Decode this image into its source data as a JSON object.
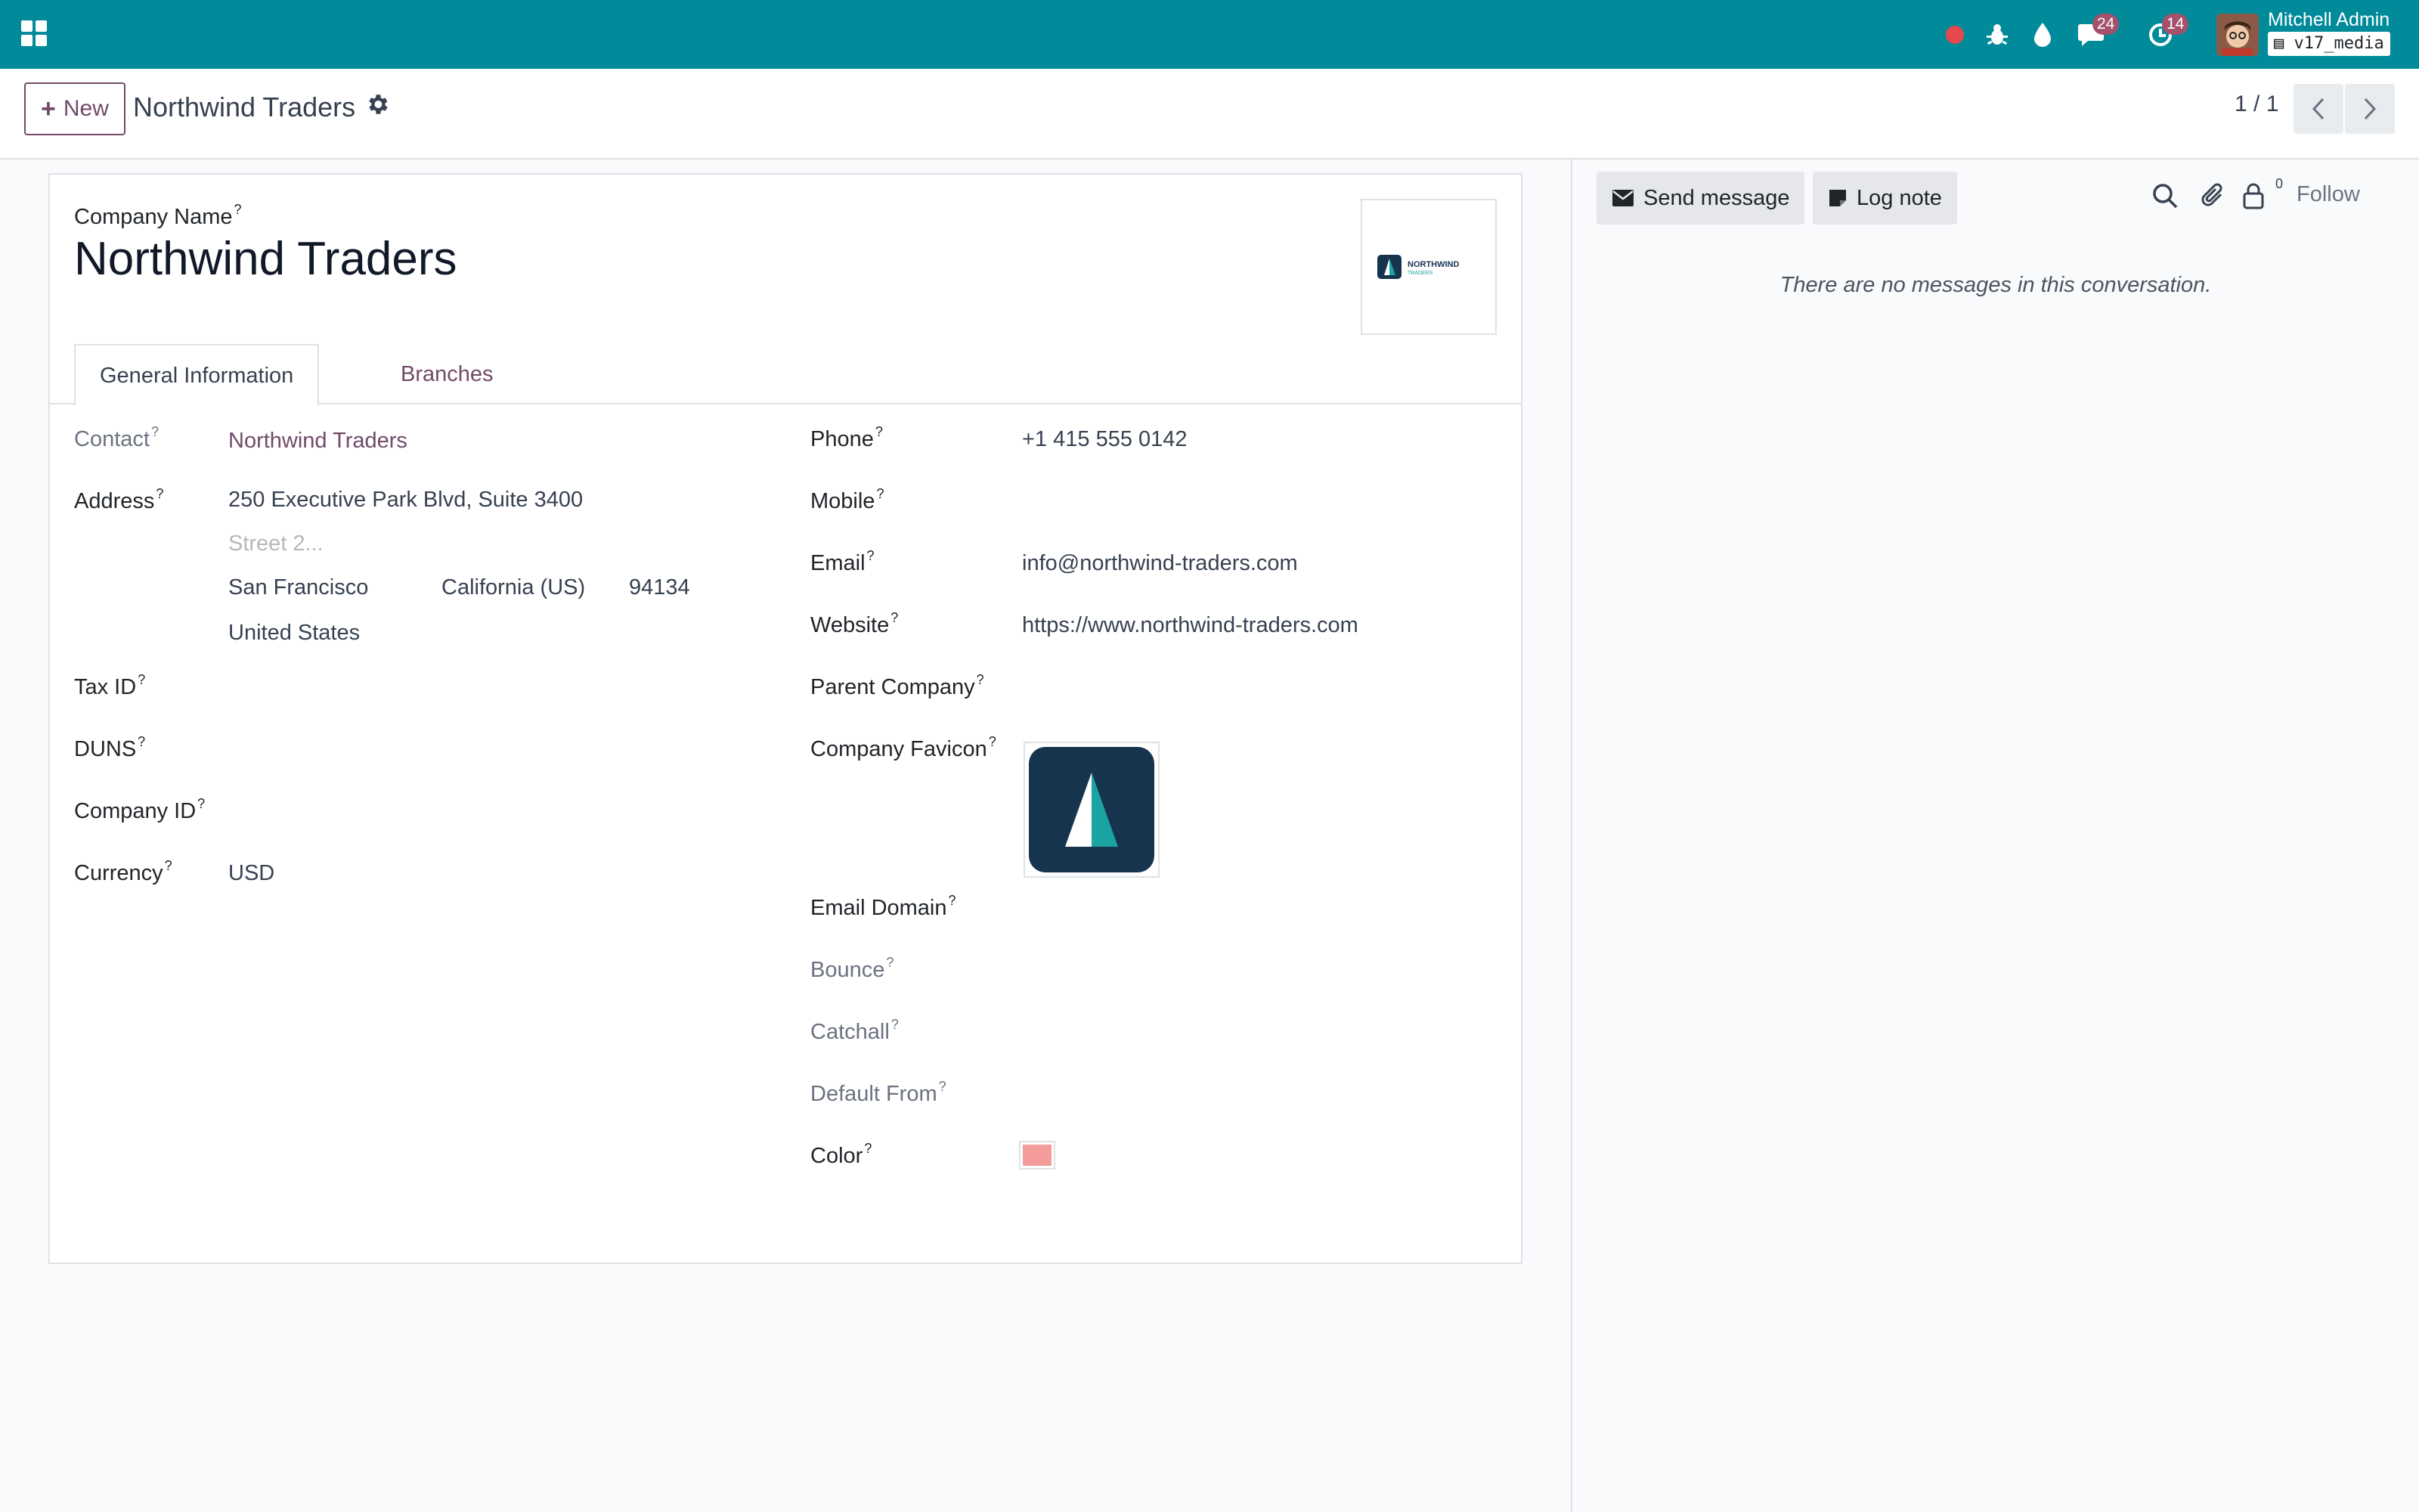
{
  "navbar": {
    "icons": [
      "apps-grid-icon",
      "recording-dot-icon",
      "bug-icon",
      "droplet-icon",
      "chat-icon",
      "activity-clock-icon"
    ],
    "messages_badge": "24",
    "activities_badge": "14",
    "user_name": "Mitchell Admin",
    "database": "v17_media",
    "colors": {
      "navbar_bg": "#018a9a",
      "badge": "#a3516c",
      "record_dot": "#e5484d"
    }
  },
  "control_panel": {
    "new_button": "New",
    "breadcrumb_title": "Northwind Traders",
    "pager": "1 / 1"
  },
  "form": {
    "company_name_label": "Company Name",
    "company_name": "Northwind Traders",
    "logo_text": "NORTHWIND",
    "logo_subtext": "TRADERS",
    "tabs": [
      {
        "label": "General Information",
        "active": true
      },
      {
        "label": "Branches",
        "active": false
      }
    ],
    "left": {
      "contact_label": "Contact",
      "contact_value": "Northwind Traders",
      "address_label": "Address",
      "street": "250 Executive Park Blvd, Suite 3400",
      "street2_placeholder": "Street 2...",
      "city": "San Francisco",
      "state": "California (US)",
      "zip": "94134",
      "country": "United States",
      "tax_id_label": "Tax ID",
      "duns_label": "DUNS",
      "company_id_label": "Company ID",
      "currency_label": "Currency",
      "currency_value": "USD"
    },
    "right": {
      "phone_label": "Phone",
      "phone_value": "+1 415 555 0142",
      "mobile_label": "Mobile",
      "email_label": "Email",
      "email_value": "info@northwind-traders.com",
      "website_label": "Website",
      "website_value": "https://www.northwind-traders.com",
      "parent_company_label": "Parent Company",
      "favicon_label": "Company Favicon",
      "email_domain_label": "Email Domain",
      "bounce_label": "Bounce",
      "catchall_label": "Catchall",
      "default_from_label": "Default From",
      "color_label": "Color",
      "color_value": "#f49b9b"
    },
    "tooltip_marker": "?"
  },
  "chatter": {
    "send_message": "Send message",
    "log_note": "Log note",
    "followers_count": "0",
    "follow": "Follow",
    "empty_text": "There are no messages in this conversation."
  }
}
